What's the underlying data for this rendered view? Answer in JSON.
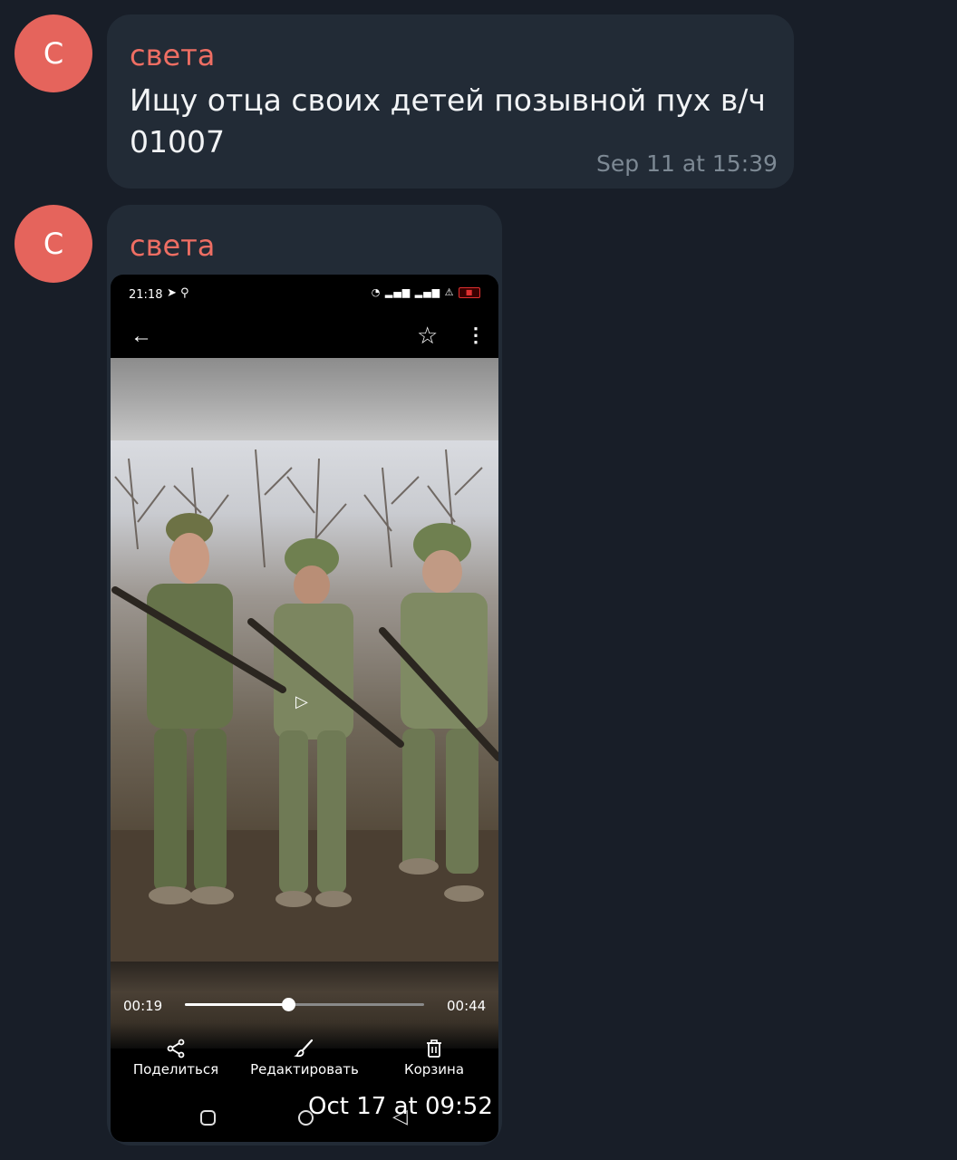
{
  "messages": [
    {
      "avatar_letter": "С",
      "sender": "света",
      "text": "Ищу отца своих детей позывной пух в/ч 01007",
      "time": "Sep 11 at 15:39"
    },
    {
      "avatar_letter": "С",
      "sender": "света",
      "time": "Oct 17 at 09:52",
      "screenshot": {
        "status_time": "21:18",
        "video_current_time": "00:19",
        "video_total_time": "00:44",
        "progress_fraction": 0.43,
        "actions": [
          "Поделиться",
          "Редактировать",
          "Корзина"
        ]
      }
    }
  ],
  "colors": {
    "background": "#181e28",
    "bubble": "#222b36",
    "avatar": "#e5645c",
    "sender": "#ee6e63",
    "text": "#f2f4f6",
    "timestamp": "#7d8994"
  },
  "icons": {
    "back": "arrow-left-icon",
    "star": "star-icon",
    "more": "more-vertical-icon",
    "share": "share-icon",
    "edit": "brush-icon",
    "delete": "trash-icon",
    "play": "play-icon"
  }
}
